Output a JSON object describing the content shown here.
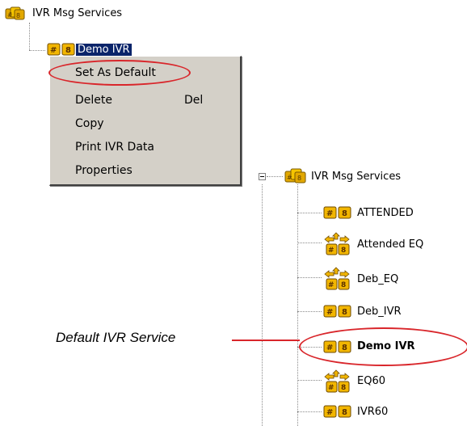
{
  "colors": {
    "highlight_ellipse": "#d9262b",
    "selection_bg": "#0a246a",
    "menu_bg": "#d4d0c8",
    "service_icon": "#e2a800"
  },
  "top_tree": {
    "root_label": "IVR Msg Services",
    "root_icon": "multi-service-icon",
    "child_label": "Demo IVR",
    "child_icon": "ivr-service-icon"
  },
  "context_menu": {
    "items": [
      {
        "label": "Set As Default",
        "shortcut": ""
      },
      {
        "label": "Delete",
        "shortcut": "Del"
      },
      {
        "label": "Copy",
        "shortcut": ""
      },
      {
        "label": "Print IVR Data",
        "shortcut": ""
      },
      {
        "label": "Properties",
        "shortcut": ""
      }
    ]
  },
  "right_tree": {
    "root_label": "IVR Msg Services",
    "items": [
      {
        "label": "ATTENDED",
        "icon": "ivr-service-icon"
      },
      {
        "label": "Attended EQ",
        "icon": "eq-service-icon"
      },
      {
        "label": "Deb_EQ",
        "icon": "eq-service-icon"
      },
      {
        "label": "Deb_IVR",
        "icon": "ivr-service-icon"
      },
      {
        "label": "Demo IVR",
        "icon": "ivr-service-icon",
        "bold": true
      },
      {
        "label": "EQ60",
        "icon": "eq-service-icon"
      },
      {
        "label": "IVR60",
        "icon": "ivr-service-icon"
      }
    ]
  },
  "callout": {
    "text": "Default IVR Service"
  }
}
